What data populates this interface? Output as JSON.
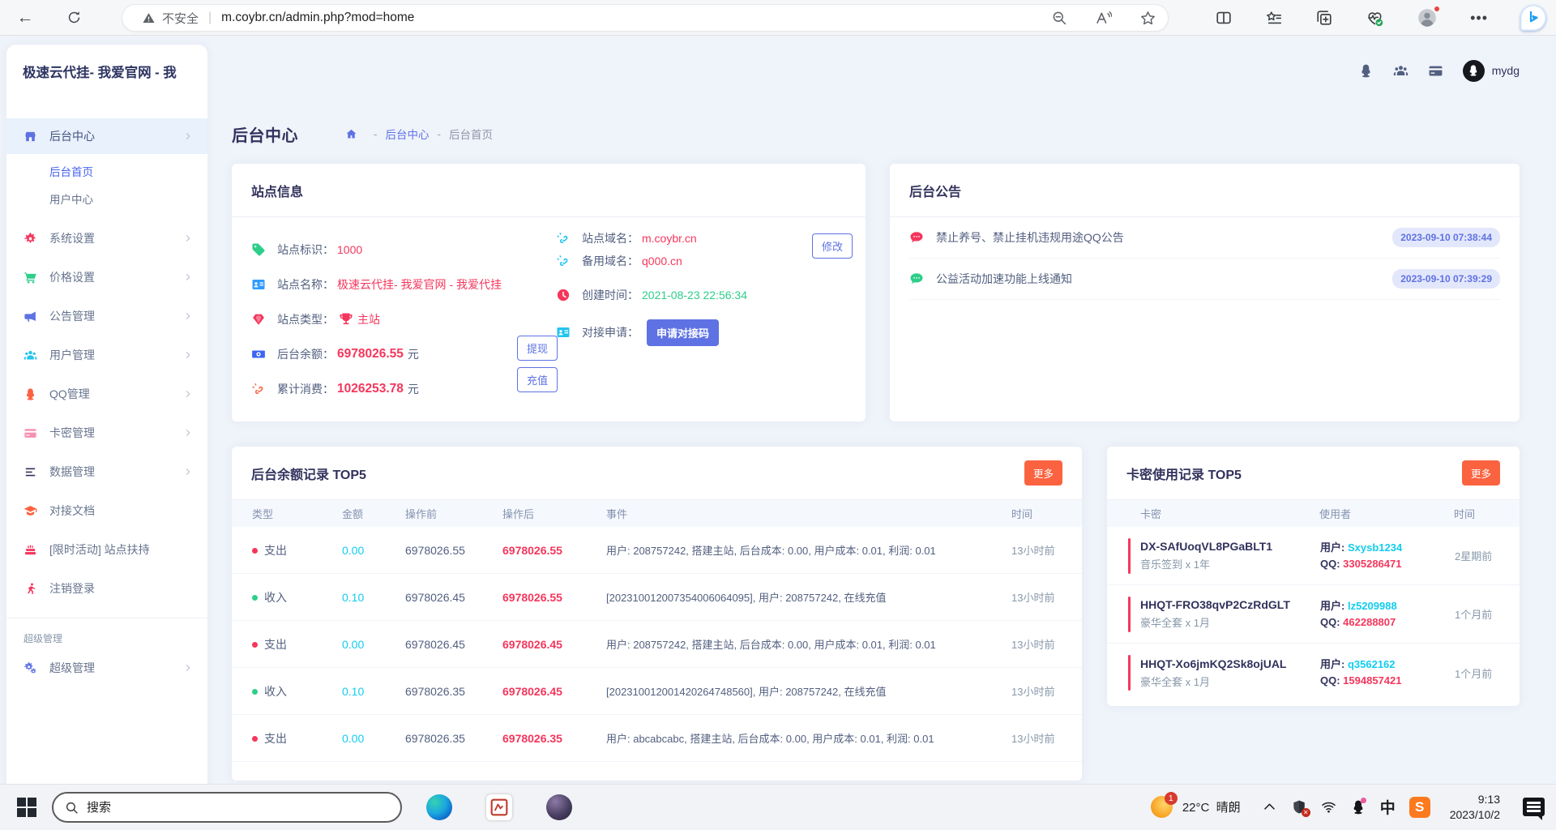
{
  "browser": {
    "security_label": "不安全",
    "url": "m.coybr.cn/admin.php?mod=home"
  },
  "header": {
    "logo": "极速云代挂- 我爱官网 - 我",
    "username": "mydg"
  },
  "sidebar": {
    "items": [
      {
        "label": "后台中心",
        "icon": "store-icon"
      },
      {
        "label": "后台首页",
        "icon": null
      },
      {
        "label": "用户中心",
        "icon": null
      },
      {
        "label": "系统设置",
        "icon": "gear-icon"
      },
      {
        "label": "价格设置",
        "icon": "cart-icon"
      },
      {
        "label": "公告管理",
        "icon": "megaphone-icon"
      },
      {
        "label": "用户管理",
        "icon": "users-icon"
      },
      {
        "label": "QQ管理",
        "icon": "qq-icon"
      },
      {
        "label": "卡密管理",
        "icon": "credit-card-icon"
      },
      {
        "label": "数据管理",
        "icon": "list-icon"
      },
      {
        "label": "对接文档",
        "icon": "graduation-cap-icon"
      },
      {
        "label": "[限时活动] 站点扶持",
        "icon": "cake-icon"
      },
      {
        "label": "注销登录",
        "icon": "runner-icon"
      }
    ],
    "section_label": "超级管理",
    "super_label": "超级管理"
  },
  "breadcrumb": {
    "title": "后台中心",
    "sep": "-",
    "home": "后台中心",
    "current": "后台首页"
  },
  "site_info": {
    "title": "站点信息",
    "id_label": "站点标识：",
    "id": "1000",
    "name_label": "站点名称：",
    "name": "极速云代挂- 我爱官网 - 我爱代挂",
    "type_label": "站点类型：",
    "type": "主站",
    "balance_label": "后台余额：",
    "balance": "6978026.55",
    "consume_label": "累计消费：",
    "consume": "1026253.78",
    "unit": "元",
    "withdraw_label": "提现",
    "recharge_label": "充值",
    "domain_label": "站点域名：",
    "domain": "m.coybr.cn",
    "modify_label": "修改",
    "backup_label": "备用域名：",
    "backup": "q000.cn",
    "created_label": "创建时间：",
    "created": "2021-08-23 22:56:34",
    "apply_label": "对接申请：",
    "apply_button": "申请对接码"
  },
  "announcements": {
    "title": "后台公告",
    "items": [
      {
        "text": "禁止养号、禁止挂机违规用途QQ公告",
        "time": "2023-09-10 07:38:44",
        "color": "#f5365c"
      },
      {
        "text": "公益活动加速功能上线通知",
        "time": "2023-09-10 07:39:29",
        "color": "#2dce89"
      }
    ]
  },
  "balance_table": {
    "title": "后台余额记录 TOP5",
    "more_label": "更多",
    "headers": [
      "类型",
      "金额",
      "操作前",
      "操作后",
      "事件",
      "时间"
    ],
    "rows": [
      {
        "type": "支出",
        "dot": "red",
        "amount": "0.00",
        "before": "6978026.55",
        "after": "6978026.55",
        "event": "用户: 208757242, 搭建主站, 后台成本: 0.00, 用户成本: 0.01, 利润: 0.01",
        "time": "13小时前"
      },
      {
        "type": "收入",
        "dot": "green",
        "amount": "0.10",
        "before": "6978026.45",
        "after": "6978026.55",
        "event": "[202310012007354006064095], 用户: 208757242, 在线充值",
        "time": "13小时前"
      },
      {
        "type": "支出",
        "dot": "red",
        "amount": "0.00",
        "before": "6978026.45",
        "after": "6978026.45",
        "event": "用户: 208757242, 搭建主站, 后台成本: 0.00, 用户成本: 0.01, 利润: 0.01",
        "time": "13小时前"
      },
      {
        "type": "收入",
        "dot": "green",
        "amount": "0.10",
        "before": "6978026.35",
        "after": "6978026.45",
        "event": "[202310012001420264748560], 用户: 208757242, 在线充值",
        "time": "13小时前"
      },
      {
        "type": "支出",
        "dot": "red",
        "amount": "0.00",
        "before": "6978026.35",
        "after": "6978026.35",
        "event": "用户: abcabcabc, 搭建主站, 后台成本: 0.00, 用户成本: 0.01, 利润: 0.01",
        "time": "13小时前"
      }
    ]
  },
  "card_table": {
    "title": "卡密使用记录 TOP5",
    "more_label": "更多",
    "headers": [
      "卡密",
      "使用者",
      "时间"
    ],
    "user_label": "用户: ",
    "qq_label": "QQ: ",
    "rows": [
      {
        "code": "DX-SAfUoqVL8PGaBLT1",
        "desc": "音乐签到 x 1年",
        "user": "Sxysb1234",
        "qq": "3305286471",
        "time": "2星期前"
      },
      {
        "code": "HHQT-FRO38qvP2CzRdGLT",
        "desc": "豪华全套 x 1月",
        "user": "lz5209988",
        "qq": "462288807",
        "time": "1个月前"
      },
      {
        "code": "HHQT-Xo6jmKQ2Sk8ojUAL",
        "desc": "豪华全套 x 1月",
        "user": "q3562162",
        "qq": "1594857421",
        "time": "1个月前"
      }
    ]
  },
  "taskbar": {
    "search_placeholder": "搜索",
    "weather_temp": "22°C",
    "weather_desc": "晴朗",
    "weather_badge": "1",
    "ime_label": "中",
    "sogou_label": "S",
    "time": "9:13",
    "date": "2023/10/2"
  },
  "colors": {
    "accent": "#5e72e4",
    "danger": "#f5365c",
    "success": "#2dce89",
    "info": "#11cdef",
    "warning": "#fb6340"
  }
}
